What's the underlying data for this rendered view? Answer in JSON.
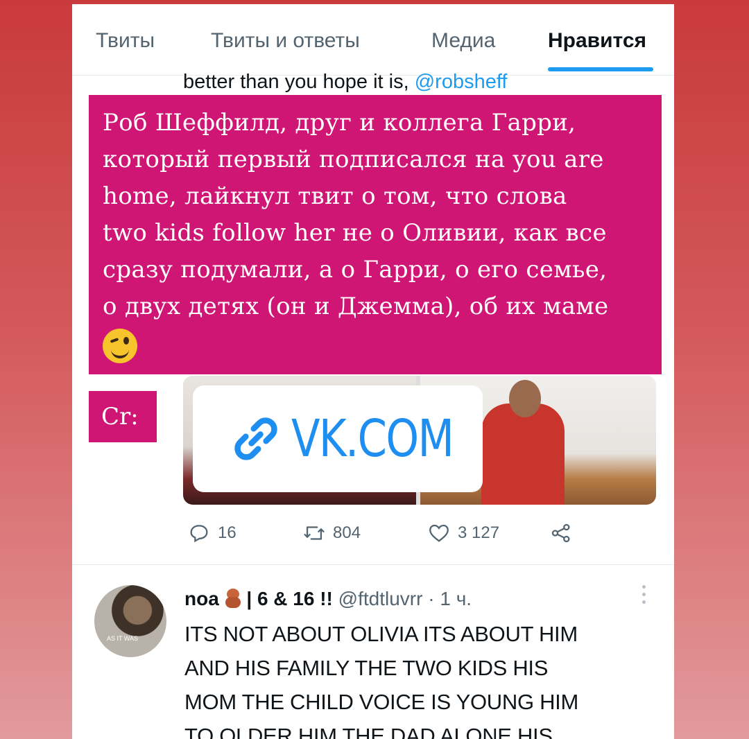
{
  "tabs": [
    "Твиты",
    "Твиты и ответы",
    "Медиа",
    "Нравится"
  ],
  "active_tab": "Нравится",
  "tweet1": {
    "tail_text": "better than you hope it is, ",
    "tail_handle": "@robsheff",
    "replies": "16",
    "retweets": "804",
    "likes": "3 127"
  },
  "overlay": {
    "lines": [
      "Роб Шеффилд, друг и коллега Гарри,",
      "который первый подписался на you are",
      "home, лайкнул твит о том, что слова",
      "two kids follow her не о Оливии, как все",
      "сразу подумали, а о Гарри, о его семье,",
      "о двух детях (он и Джемма), об их маме"
    ],
    "emoji": "winking-face-emoji",
    "cr_label": "Cr:"
  },
  "link_sticker": {
    "text": "VK.COM",
    "icon": "link-icon",
    "color": "#1e8ff0"
  },
  "tweet2": {
    "name": "noa",
    "name_suffix": "| 6 & 16 !!",
    "handle": "@ftdtluvrr",
    "time": "· 1 ч.",
    "avatar_caption": "AS IT WAS",
    "lines": [
      "ITS NOT ABOUT OLIVIA ITS ABOUT HIM",
      "AND HIS FAMILY THE TWO KIDS HIS",
      "MOM THE CHILD VOICE IS YOUNG HIM",
      "TO OLDER HIM THE DAD ALONE HIS"
    ]
  },
  "colors": {
    "accent": "#1d9bf0",
    "overlay": "#d01675",
    "text": "#0f1419",
    "muted": "#536471"
  }
}
